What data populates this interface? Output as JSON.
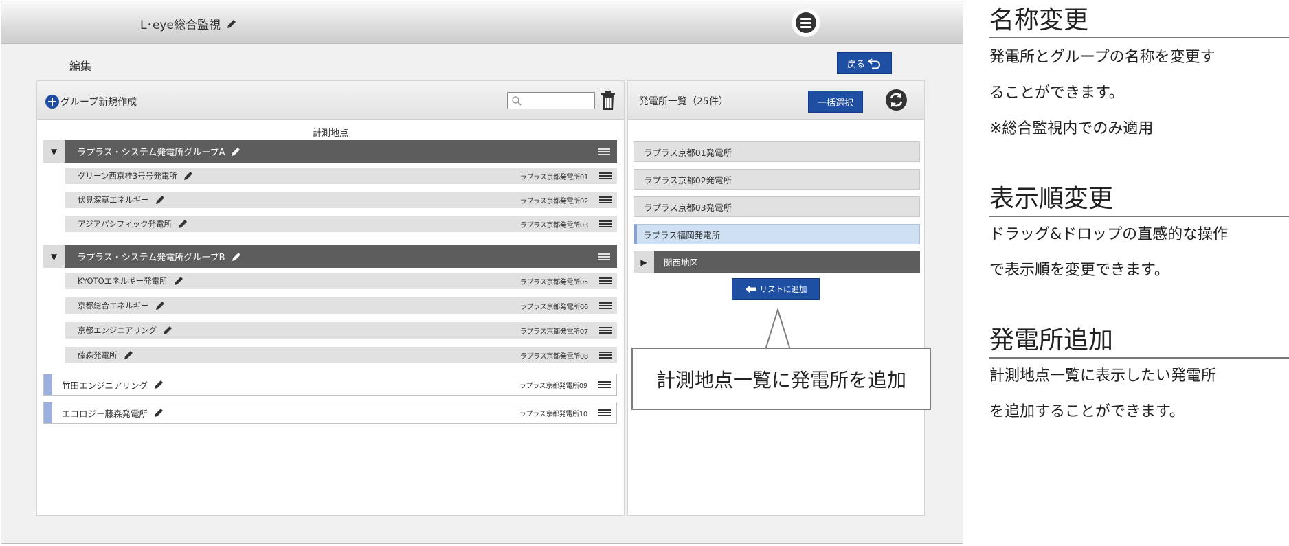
{
  "app": {
    "title": "L･eye総合監視",
    "edit_label": "編集",
    "back_label": "戻る"
  },
  "left_panel": {
    "new_group_label": "グループ新規作成",
    "search": {
      "value": "",
      "placeholder": ""
    },
    "section_title": "計測地点",
    "groups": [
      {
        "name": "ラプラス・システム発電所グループA",
        "toggle": "▼",
        "stations": [
          {
            "name": "グリーン西京桂3号号発電所",
            "code": "ラプラス京都発電所01"
          },
          {
            "name": "伏見深草エネルギー",
            "code": "ラプラス京都発電所02"
          },
          {
            "name": "アジアパシフィック発電所",
            "code": "ラプラス京都発電所03"
          }
        ]
      },
      {
        "name": "ラプラス・システム発電所グループB",
        "toggle": "▼",
        "stations": [
          {
            "name": "KYOTOエネルギー発電所",
            "code": "ラプラス京都発電所05"
          },
          {
            "name": "京都総合エネルギー",
            "code": "ラプラス京都発電所06"
          },
          {
            "name": "京都エンジニアリング",
            "code": "ラプラス京都発電所07"
          },
          {
            "name": "藤森発電所",
            "code": "ラプラス京都発電所08"
          }
        ]
      }
    ],
    "ungrouped": [
      {
        "name": "竹田エンジニアリング",
        "code": "ラプラス京都発電所09"
      },
      {
        "name": "エコロジー藤森発電所",
        "code": "ラプラス京都発電所10"
      }
    ]
  },
  "right_panel": {
    "title": "発電所一覧（25件）",
    "bulk_select_label": "一括選択",
    "stations": [
      {
        "name": "ラプラス京都01発電所",
        "selected": false
      },
      {
        "name": "ラプラス京都02発電所",
        "selected": false
      },
      {
        "name": "ラプラス京都03発電所",
        "selected": false
      },
      {
        "name": "ラプラス福岡発電所",
        "selected": true
      }
    ],
    "region_group": {
      "name": "関西地区",
      "toggle": "▶"
    },
    "add_to_list_label": "リストに追加"
  },
  "callout": {
    "text": "計測地点一覧に発電所を追加"
  },
  "info": {
    "sections": [
      {
        "heading": "名称変更",
        "lines": [
          "発電所とグループの名称を変更す",
          "ることができます。",
          "※総合監視内でのみ適用"
        ]
      },
      {
        "heading": "表示順変更",
        "lines": [
          "ドラッグ&ドロップの直感的な操作",
          "で表示順を変更できます。"
        ]
      },
      {
        "heading": "発電所追加",
        "lines": [
          "計測地点一覧に表示したい発電所",
          "を追加することができます。"
        ]
      }
    ]
  },
  "colors": {
    "accent_blue": "#1e4fa3",
    "group_bar": "#5d5d5d",
    "selected_row": "#cfe0f3",
    "ungrouped_marker": "#9bb0dc"
  }
}
